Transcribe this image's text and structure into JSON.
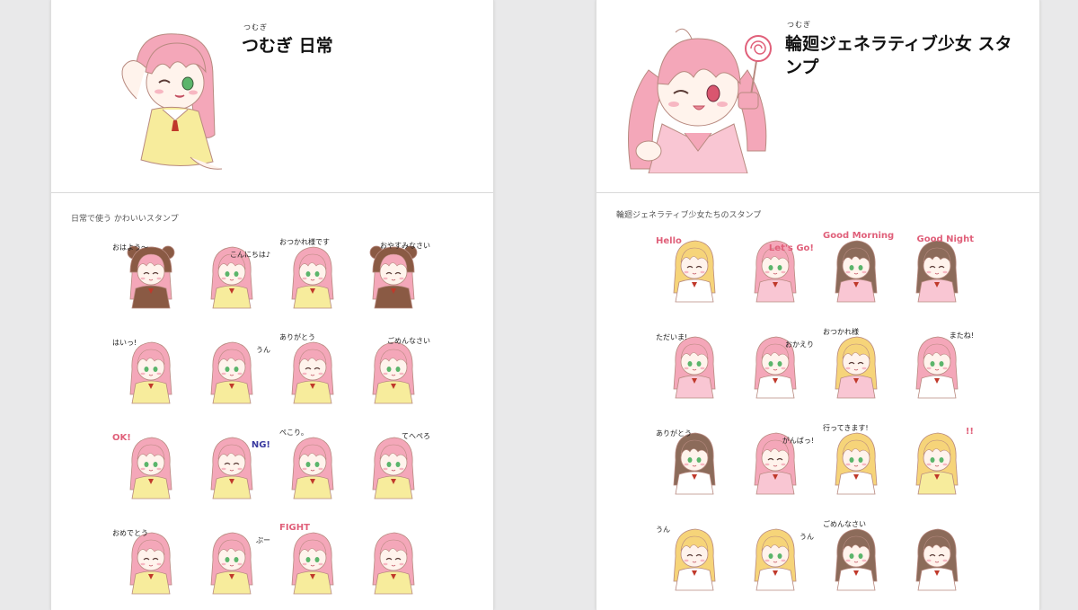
{
  "colors": {
    "hair_pink": "#f4a7b9",
    "hair_light": "#f9c6d3",
    "dress_yellow": "#f7ec9c",
    "outline": "#b88a80",
    "bear_brown": "#8a5a44",
    "blonde": "#f6d479",
    "brunette": "#8c6b5a"
  },
  "left": {
    "ruby": "つむぎ",
    "title": "つむぎ 日常",
    "description": "日常で使う かわいいスタンプ",
    "stickers": [
      {
        "text": "おはよう〜",
        "hair": "#f4a7b9",
        "outfit": "#8a5a44",
        "bear": true
      },
      {
        "text": "こんにちは♪",
        "hair": "#f4a7b9",
        "outfit": "#f7ec9c",
        "bear": false
      },
      {
        "text": "おつかれ様です",
        "hair": "#f4a7b9",
        "outfit": "#f7ec9c",
        "bear": false
      },
      {
        "text": "おやすみなさい",
        "hair": "#f4a7b9",
        "outfit": "#8a5a44",
        "bear": true
      },
      {
        "text": "はいっ!",
        "hair": "#f4a7b9",
        "outfit": "#f7ec9c",
        "bear": false
      },
      {
        "text": "うん",
        "hair": "#f4a7b9",
        "outfit": "#f7ec9c",
        "bear": false
      },
      {
        "text": "ありがとう",
        "hair": "#f4a7b9",
        "outfit": "#f7ec9c",
        "bear": false
      },
      {
        "text": "ごめんなさい",
        "hair": "#f4a7b9",
        "outfit": "#f7ec9c",
        "bear": false
      },
      {
        "text": "OK!",
        "hair": "#f4a7b9",
        "outfit": "#f7ec9c",
        "bear": false
      },
      {
        "text": "NG!",
        "hair": "#f4a7b9",
        "outfit": "#f7ec9c",
        "bear": false
      },
      {
        "text": "ぺこり。",
        "hair": "#f4a7b9",
        "outfit": "#f7ec9c",
        "bear": false
      },
      {
        "text": "てへぺろ",
        "hair": "#f4a7b9",
        "outfit": "#f7ec9c",
        "bear": false
      },
      {
        "text": "おめでとう",
        "hair": "#f4a7b9",
        "outfit": "#f7ec9c",
        "bear": false
      },
      {
        "text": "ぷー",
        "hair": "#f4a7b9",
        "outfit": "#f7ec9c",
        "bear": false
      },
      {
        "text": "FIGHT",
        "hair": "#f4a7b9",
        "outfit": "#f7ec9c",
        "bear": false
      },
      {
        "text": "",
        "hair": "#f4a7b9",
        "outfit": "#f7ec9c",
        "bear": false
      }
    ]
  },
  "right": {
    "ruby": "つむぎ",
    "title": "輪廻ジェネラティブ少女 スタンプ",
    "description": "輪廻ジェネラティブ少女たちのスタンプ",
    "stickers": [
      {
        "text": "Hello",
        "hair": "#f6d479",
        "outfit": "#ffffff",
        "bear": false
      },
      {
        "text": "Let's Go!",
        "hair": "#f4a7b9",
        "outfit": "#f9c6d3",
        "bear": false
      },
      {
        "text": "Good Morning",
        "hair": "#8c6b5a",
        "outfit": "#f9c6d3",
        "bear": false
      },
      {
        "text": "Good Night",
        "hair": "#8c6b5a",
        "outfit": "#f9c6d3",
        "bear": false
      },
      {
        "text": "ただいま!",
        "hair": "#f4a7b9",
        "outfit": "#f9c6d3",
        "bear": false
      },
      {
        "text": "おかえり",
        "hair": "#f4a7b9",
        "outfit": "#ffffff",
        "bear": false
      },
      {
        "text": "おつかれ様",
        "hair": "#f6d479",
        "outfit": "#f9c6d3",
        "bear": false
      },
      {
        "text": "またね!",
        "hair": "#f4a7b9",
        "outfit": "#ffffff",
        "bear": false
      },
      {
        "text": "ありがとう",
        "hair": "#8c6b5a",
        "outfit": "#ffffff",
        "bear": false
      },
      {
        "text": "がんばっ!",
        "hair": "#f4a7b9",
        "outfit": "#f9c6d3",
        "bear": false
      },
      {
        "text": "行ってきます!",
        "hair": "#f6d479",
        "outfit": "#ffffff",
        "bear": false
      },
      {
        "text": "!!",
        "hair": "#f6d479",
        "outfit": "#f7ec9c",
        "bear": false
      },
      {
        "text": "うん",
        "hair": "#f6d479",
        "outfit": "#ffffff",
        "bear": false
      },
      {
        "text": "うん",
        "hair": "#f6d479",
        "outfit": "#ffffff",
        "bear": false
      },
      {
        "text": "ごめんなさい",
        "hair": "#8c6b5a",
        "outfit": "#ffffff",
        "bear": false
      },
      {
        "text": "",
        "hair": "#8c6b5a",
        "outfit": "#ffffff",
        "bear": false
      }
    ]
  }
}
